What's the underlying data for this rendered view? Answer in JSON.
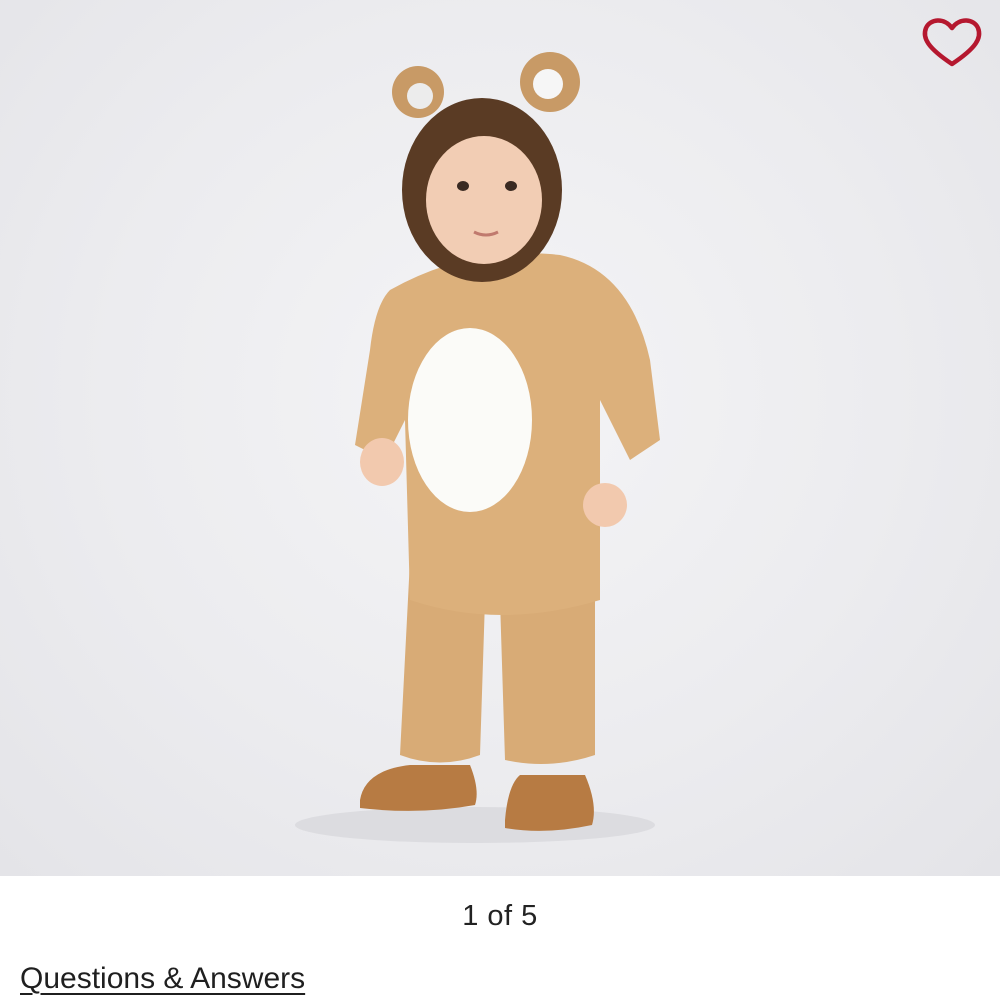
{
  "gallery": {
    "image_name": "bear-costume-photo",
    "counter_text": "1 of 5",
    "current": 1,
    "total": 5
  },
  "favorite": {
    "icon": "heart-outline-icon",
    "color": "#b5182f"
  },
  "questions_link": "Questions & Answers",
  "colors": {
    "costume": "#d9ad78",
    "belly": "#fbfbf8",
    "mane": "#5a3b24",
    "shoes": "#b77b43"
  }
}
